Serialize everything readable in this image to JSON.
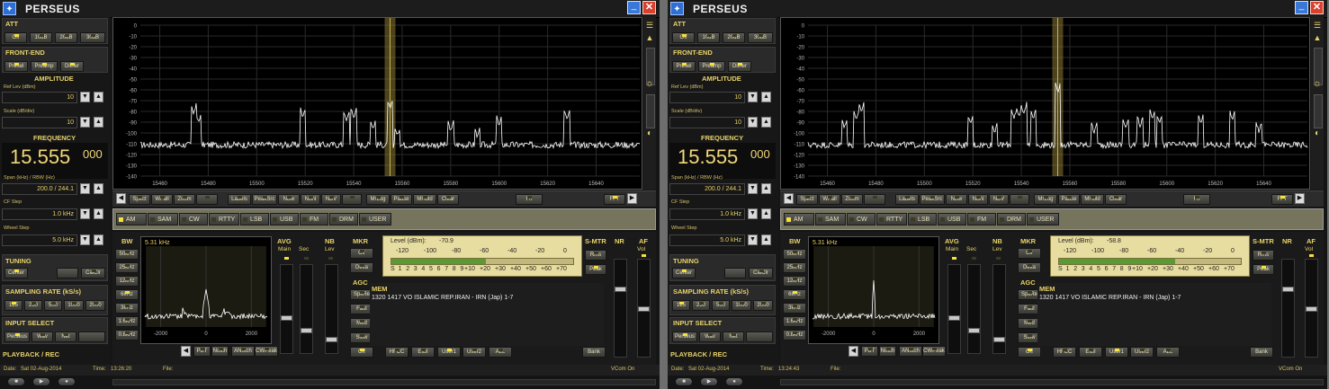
{
  "colors": {
    "accent": "#e8d36a",
    "led_on": "#f6e03a",
    "trace": "#ffffff",
    "marker": "#8b7a35"
  },
  "app": {
    "title": "PERSEUS",
    "minimize_label": "_",
    "close_label": "✕",
    "app_icon": "perseus-logo-icon"
  },
  "side": {
    "att": {
      "title": "ATT",
      "buttons": [
        "Off",
        "10dB",
        "20dB",
        "30dB"
      ]
    },
    "frontend": {
      "title": "FRONT-END",
      "buttons": [
        "Presel",
        "Preamp",
        "Dither"
      ]
    },
    "amplitude": {
      "title": "AMPLITUDE",
      "ref_label": "Ref Lev (dBm)",
      "ref_value": "10",
      "scale_label": "Scale (dB/div)",
      "scale_value": "10"
    },
    "frequency": {
      "title": "FREQUENCY",
      "main": "15.555",
      "sub": "000",
      "span_label": "Span (kHz) / RBW (Hz)",
      "span_value": "200.0 / 244.1",
      "cf_label": "CF Step",
      "cf_value": "1.0 kHz",
      "wheel_label": "Wheel Step",
      "wheel_value": "5.0 kHz"
    },
    "tuning": {
      "title": "TUNING",
      "buttons": [
        "Center",
        "",
        "CalClr"
      ]
    },
    "sampling": {
      "title": "SAMPLING RATE (kS/s)",
      "buttons": [
        "125",
        "250",
        "500",
        "1000",
        "2000"
      ]
    },
    "input": {
      "title": "INPUT SELECT",
      "buttons": [
        "Perseus",
        "Wav",
        "Net",
        ""
      ]
    },
    "playback": {
      "title": "PLAYBACK / REC"
    }
  },
  "spectrum": {
    "y_ticks": [
      "0",
      "-10",
      "-20",
      "-30",
      "-40",
      "-50",
      "-60",
      "-70",
      "-80",
      "-90",
      "-100",
      "-110",
      "-120",
      "-130",
      "-140"
    ],
    "x_ticks": [
      "15460",
      "15480",
      "15500",
      "15520",
      "15540",
      "15560",
      "15580",
      "15600",
      "15620",
      "15640"
    ],
    "x_range": [
      15452,
      15658
    ],
    "y_range": [
      -140,
      0
    ],
    "marker_freq": 15555
  },
  "toolbar": {
    "left_arrow": "◀",
    "right_arrow": "▶",
    "buttons": [
      "Spect",
      "WFall",
      "Zoom",
      "",
      "Labels",
      "PeakSrc",
      "NBw",
      "NBN",
      "NBV",
      "",
      "MrLog",
      "Pause",
      "MHold",
      "Clear",
      "Fn"
    ],
    "fft": "FFT"
  },
  "modes": [
    "AM",
    "SAM",
    "CW",
    "RTTY",
    "LSB",
    "USB",
    "FM",
    "DRM",
    "USER"
  ],
  "bw": {
    "title": "BW",
    "items": [
      "50kHz",
      "25kHz",
      "12kHz",
      "6kHz",
      "3kHz",
      "1.6kHz",
      "0.8kHz"
    ],
    "readout": "5.31 kHz",
    "x_ticks": [
      "-2000",
      "0",
      "2000"
    ],
    "bottom_buttons": [
      "PBT",
      "Notch",
      "ANotch",
      "CWPeak"
    ]
  },
  "avg": {
    "title": "AVG",
    "main": "Main",
    "sec": "Sec"
  },
  "nb": {
    "title": "NB",
    "lev": "Lev"
  },
  "mkr": {
    "title": "MKR",
    "buttons": [
      "Clr",
      "Delta"
    ]
  },
  "agc": {
    "title": "AGC",
    "buttons": [
      "SpkRe",
      "Fast",
      "Med",
      "Slow",
      "Off"
    ]
  },
  "meter": {
    "level_prefix": "Level (dBm):",
    "dbm_scale": [
      "-120",
      "-100",
      "-80",
      "-60",
      "-40",
      "-20",
      "0"
    ],
    "s_scale": [
      "S",
      "1",
      "2",
      "3",
      "4",
      "5",
      "6",
      "7",
      "8",
      "9",
      "+10",
      "+20",
      "+30",
      "+40",
      "+50",
      "+60",
      "+70"
    ]
  },
  "smtr": {
    "title": "S-MTR",
    "buttons": [
      "Rms",
      "Peak"
    ]
  },
  "nr": {
    "title": "NR"
  },
  "af": {
    "title": "AF",
    "vol": "Vol"
  },
  "mem": {
    "title": "MEM",
    "entry": "1320 1417 VO ISLAMIC REP.IRAN  - IRN (Jap)  1-7",
    "buttons": [
      "HFCC",
      "EIBI",
      "User1",
      "User2",
      "ALL"
    ],
    "bank": "Bank"
  },
  "status": {
    "date_label": "Date:",
    "date_value": "Sat 02-Aug-2014",
    "time_label": "Time:",
    "file_label": "File:",
    "vcom": "VCom On"
  },
  "playback_controls": {
    "stop": "■",
    "play": "▶",
    "record": "●"
  },
  "windows": [
    {
      "time": "13:26:20",
      "level_dbm": "-70.9",
      "meter_fill_fraction": 0.52
    },
    {
      "time": "13:24:43",
      "level_dbm": "-58.8",
      "meter_fill_fraction": 0.64
    }
  ]
}
